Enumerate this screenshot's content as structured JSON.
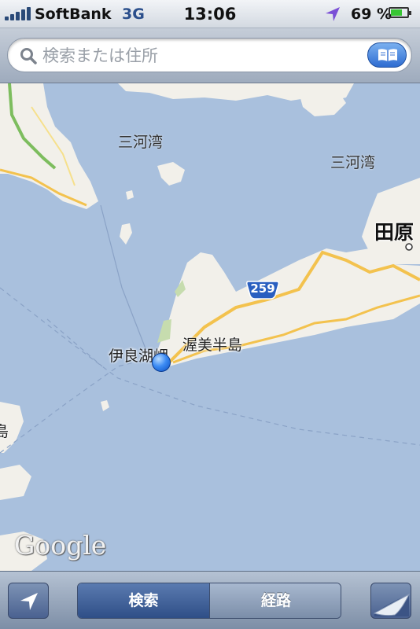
{
  "status_bar": {
    "carrier": "SoftBank",
    "network": "3G",
    "time": "13:06",
    "battery_percent": "69 %",
    "battery_level": 0.69,
    "signal_bars": 5
  },
  "search": {
    "placeholder": "検索または住所",
    "value": ""
  },
  "map": {
    "labels": {
      "bay_1": "三河湾",
      "bay_2": "三河湾",
      "city": "田原",
      "peninsula": "渥美半島",
      "cape": "伊良湖岬",
      "island": "島",
      "route_number": "259"
    },
    "attribution": "Google",
    "colors": {
      "water": "#a9c0dd",
      "land": "#f2f0ea",
      "road": "#f3c24e",
      "park": "#c6dcae"
    }
  },
  "toolbar": {
    "segments": [
      {
        "label": "検索",
        "selected": true
      },
      {
        "label": "経路",
        "selected": false
      }
    ]
  },
  "icons": {
    "status": [
      "signal-icon",
      "location-arrow-icon",
      "battery-icon"
    ],
    "search": [
      "search-icon",
      "bookmarks-icon"
    ],
    "toolbar": [
      "locate-icon",
      "page-curl-icon"
    ]
  }
}
